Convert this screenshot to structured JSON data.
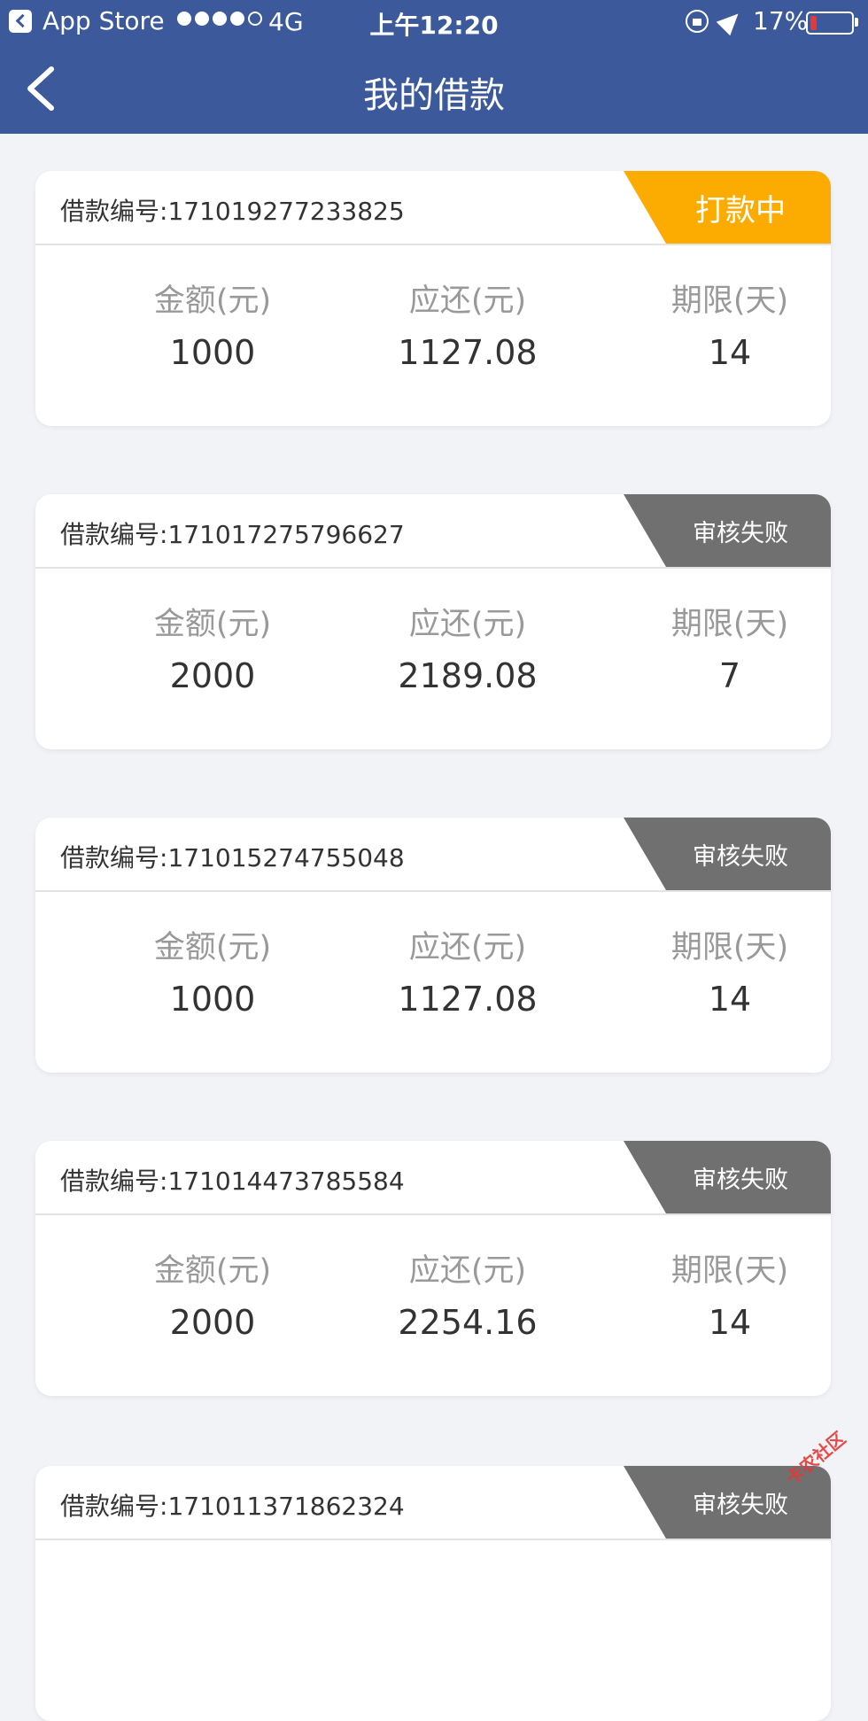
{
  "status_bar": {
    "app": "App Store",
    "network": "4G",
    "time": "上午12:20",
    "battery": "17%",
    "battery_level": 0.17,
    "signal_bars": 4,
    "signal_total": 5
  },
  "nav": {
    "title": "我的借款"
  },
  "loan_label": "借款编号:",
  "columns": {
    "amount": "金额(元)",
    "repay": "应还(元)",
    "term": "期限(天)"
  },
  "loans": [
    {
      "id": "171019277233825",
      "status": "打款中",
      "amount": "1000",
      "repay": "1127.08",
      "term": "14"
    },
    {
      "id": "171017275796627",
      "status": "审核失败",
      "amount": "2000",
      "repay": "2189.08",
      "term": "7"
    },
    {
      "id": "171015274755048",
      "status": "审核失败",
      "amount": "1000",
      "repay": "1127.08",
      "term": "14"
    },
    {
      "id": "171014473785584",
      "status": "审核失败",
      "amount": "2000",
      "repay": "2254.16",
      "term": "14"
    },
    {
      "id": "171011371862324",
      "status": "审核失败"
    }
  ],
  "watermark": "卡农社区",
  "colors": {
    "header": "#3c5a9b",
    "paying": "#fcac00",
    "failed": "#707070",
    "background": "#f2f3f7"
  }
}
